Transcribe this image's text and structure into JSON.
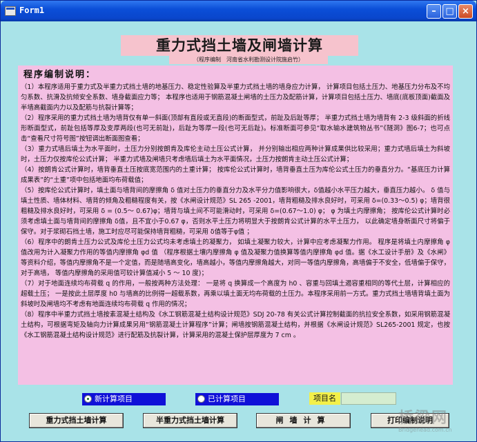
{
  "window": {
    "title": "Form1"
  },
  "banner": {
    "title": "重力式挡土墙及闸墙计算",
    "credit": "（程序编制　河南省水利勘测设计院施启竹）"
  },
  "description": {
    "heading": "程序编制说明：",
    "paragraphs": [
      "（1）本程序适用于重力式及半重力式挡土墙的地基压力、稳定性验算及半重力式挡土墙的墙身应力计算， 计算项目包括土压力、地基压力分布及不均匀系数、抗滑及抗倾安全系数、墙身截面应力等； 本程序也适用于钢筋混凝土闸墙的土压力及配筋计算，计算项目包括土压力、墙底(底板顶面)截面及半墙高截面内力以及配筋与抗裂计算等；",
      "（2）程序采用的重力式挡土墙为墙背仅有单一斜面(顶部有直段或无直段)的断面型式，前趾及后趾等厚； 半重力式挡土墙为墙背有 2-3 级斜面的折线形断面型式，前趾包括等厚及变厚两段(也可无前趾)，后趾为等厚一段(也可无后趾)。标准断面可参见“取水输水建筑物丛书”《隧洞》图6-7；也可点击“查看尺寸符号图”按钮调出断面图查看；",
      "（3）重力式墙后填土为水平面时，土压力分别按朗肯及库伦主动土压公式计算， 并分别输出相应两种计算成果供比较采用；重力式墙后填土为斜坡时，土压力仅按库伦公式计算； 半重力式墙及闸墙只考虑墙后填土为水平面情况，土压力按朗肯主动土压公式计算；",
      "（4）按朗肯公式计算时，墙背垂直土压按底宽范围内的土重计算； 按库伦公式计算时，墙背垂直土压为库伦公式土压力的垂直分力。“基底压力计算成果表”的“土重”项中包括地面均布荷载值；",
      "（5）按库伦公式计算时，填土面与墙背间的摩擦角 δ 值对土压力的垂直分力及水平分力值影响很大，δ值越小水平压力越大，垂直压力越小。 δ 值与填土性质、墙体材料、墙背的倾角及粗糙程度有关，按《水闸设计规范》SL 265 -2001，墙背粗糙及排水良好时，可采用 δ=(0.33～0.5) φ；墙背很粗糙及排水良好时，可采用 δ = (0.5～ 0.67)φ；墙背与填土间不可能滑动时，可采用 δ=(0.67～1.0) φ； φ 为填土内摩擦角； 按库伦公式计算时必须考虑填土面与墙背间的摩擦角 δ值，且不宜小于0.67 φ，否则水平土压力将明显大于按朗肯公式计算的水平土压力， 以此确定墙身断面尺寸将偏于保守。对于浆砌石挡土墙，施工时应尽可能保持墙背粗糙，可采用 δ值等于φ值 ；",
      "（6）程序中的朗肯土压力公式及库伦土压力公式均未考虑填土的凝聚力， 如填土凝聚力较大，计算中应考虑凝聚力作用。 程序是将填土内摩擦角 φ 值改用为计入凝聚力作用的等值内摩擦角 φd 值 （程序根据土壤内摩擦角 φ 值及凝聚力值换算等值内摩擦角 φd 值。据《水工设计手册》及《水闸》等资料介绍，等值内摩擦角不是一个定值，而是随墙高变化，墙高越小，等值内摩擦角越大，对同一等值内摩擦角，高墙偏于不安全，低墙偏于保守，对于高墙， 等值内摩擦角的采用值可较计算值减小 5 ～ 10 度)；",
      "（7）对于地面连续均布荷载 q 的作用，一般按两种方法处理： 一是将 q 换算成一个高度为 h0 、容重与回填土遏容重相同的等代土层，计算相应的超载土压； 一是按此土层厚度 h0 与墙高的比例得一超载系数，再乘以填土面无均布荷载的土压力。本程序采用前一方式。重力式挡土墙墙背填土面为斜坡时及闸墙均不考虑有地面连续均布荷载 q 作用的情况；",
      "（8）程序中半重力式挡土墙按素混凝土结构及《水工钢筋混凝土结构设计规范》SDJ 20-78 有关公式计算控制截面的抗拉安全系数，如采用钢筋混凝土结构，可根据弯矩及轴向力计算成果另用“钢筋混凝土计算程序”计算；闸墙按钢筋混凝土结构，并根据《水闸设计规范》SL265-2001 规定，也按《水工钢筋混凝土结构设计规范》进行配筋及抗裂计算，计算采用的混凝土保护层厚度为 7 cm 。"
    ]
  },
  "options": {
    "new_project_label": "新计算项目",
    "existing_project_label": "已计算项目",
    "selected": "new"
  },
  "project_name": {
    "label": "项目名",
    "value": ""
  },
  "buttons": {
    "gravity": "重力式挡土墙计算",
    "semi_gravity": "半重力式挡土墙计算",
    "lock_wall": "闸墙计算",
    "print": "打印编制说明"
  },
  "watermark": {
    "main": "桥梁网",
    "sub": "Bridgehead.com.cn"
  },
  "colors": {
    "form_background": "#a9e3e8",
    "description_background": "#f4c0e4",
    "banner_background": "#f6c3cd",
    "radio_background": "#1010d8",
    "label_background": "#f3f04a",
    "input_background": "#d5edd0"
  }
}
